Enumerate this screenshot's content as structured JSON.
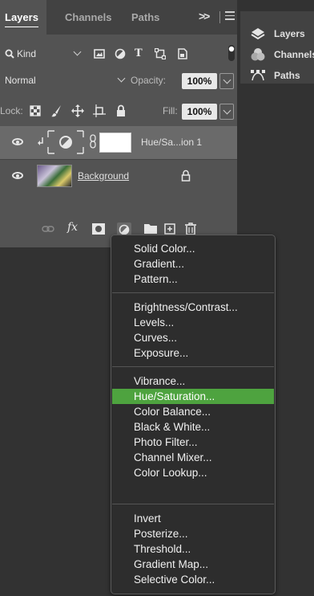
{
  "tabs": {
    "layers": "Layers",
    "channels": "Channels",
    "paths": "Paths",
    "overflow": ">>"
  },
  "filter": {
    "kind": "Kind"
  },
  "blend": {
    "mode": "Normal",
    "opacity_label": "Opacity:",
    "opacity_value": "100%"
  },
  "lock": {
    "label": "Lock:",
    "fill_label": "Fill:",
    "fill_value": "100%"
  },
  "layers": [
    {
      "name": "Hue/Sa...ion 1"
    },
    {
      "name": "Background"
    }
  ],
  "bottom_bar": {
    "fx": "fx"
  },
  "right_panel": {
    "items": [
      "Layers",
      "Channels",
      "Paths"
    ]
  },
  "menu": {
    "group1": [
      "Solid Color...",
      "Gradient...",
      "Pattern..."
    ],
    "group2": [
      "Brightness/Contrast...",
      "Levels...",
      "Curves...",
      "Exposure..."
    ],
    "group3": [
      "Vibrance...",
      "Hue/Saturation...",
      "Color Balance...",
      "Black & White...",
      "Photo Filter...",
      "Channel Mixer...",
      "Color Lookup..."
    ],
    "group4": [
      "Invert",
      "Posterize...",
      "Threshold...",
      "Gradient Map...",
      "Selective Color..."
    ],
    "highlighted": "Hue/Saturation..."
  },
  "colors": {
    "highlight": "#4ea33f",
    "panel": "#535353",
    "background": "#323232"
  }
}
